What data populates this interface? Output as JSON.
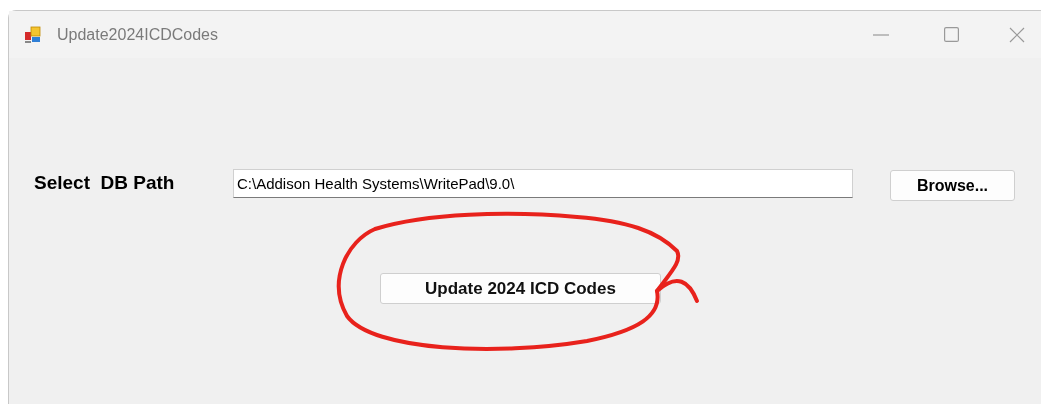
{
  "window": {
    "title": "Update2024ICDCodes"
  },
  "db_path": {
    "label": "Select  DB Path",
    "value": "C:\\Addison Health Systems\\WritePad\\9.0\\"
  },
  "buttons": {
    "browse": "Browse...",
    "update": "Update 2024 ICD Codes"
  }
}
